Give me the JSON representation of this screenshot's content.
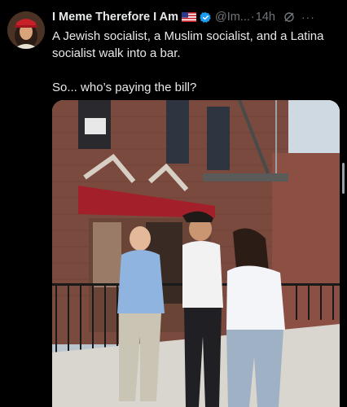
{
  "post": {
    "display_name": "I Meme Therefore I Am",
    "handle": "@Im...",
    "separator": "·",
    "time": "14h",
    "text_line1": "A Jewish socialist, a Muslim socialist, and a Latina socialist walk into a bar.",
    "text_line2": "So... who’s paying the bill?"
  },
  "icons": {
    "flag": "us-flag-icon",
    "verified": "verified-badge-icon",
    "grok": "grok-icon",
    "more": "more-options-icon"
  },
  "colors": {
    "background": "#000000",
    "text": "#e7e9ea",
    "muted": "#71767b",
    "verified": "#1d9bf0"
  }
}
